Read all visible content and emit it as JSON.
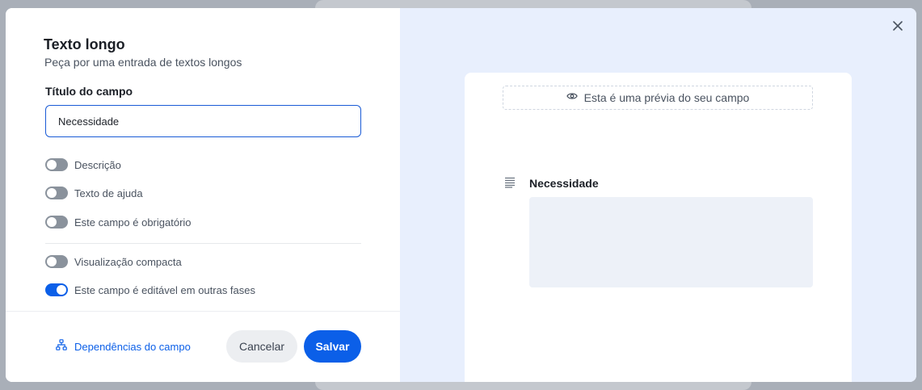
{
  "dialog": {
    "title": "Texto longo",
    "subtitle": "Peça por uma entrada de textos longos",
    "field_title_label": "Título do campo",
    "field_title_value": "Necessidade"
  },
  "toggles": [
    {
      "label": "Descrição",
      "on": false
    },
    {
      "label": "Texto de ajuda",
      "on": false
    },
    {
      "label": "Este campo é obrigatório",
      "on": false
    },
    {
      "label": "Visualização compacta",
      "on": false
    },
    {
      "label": "Este campo é editável em outras fases",
      "on": true
    }
  ],
  "footer": {
    "dependencies_label": "Dependências do campo",
    "cancel_label": "Cancelar",
    "save_label": "Salvar"
  },
  "preview": {
    "banner_text": "Esta é uma prévia do seu campo",
    "field_title": "Necessidade"
  },
  "icons": {
    "close": "close-icon",
    "eye": "eye-icon",
    "dependencies": "sitemap-icon",
    "long_text": "text-lines-icon"
  },
  "colors": {
    "accent": "#0b5fe8",
    "preview_background": "#e8effd"
  }
}
